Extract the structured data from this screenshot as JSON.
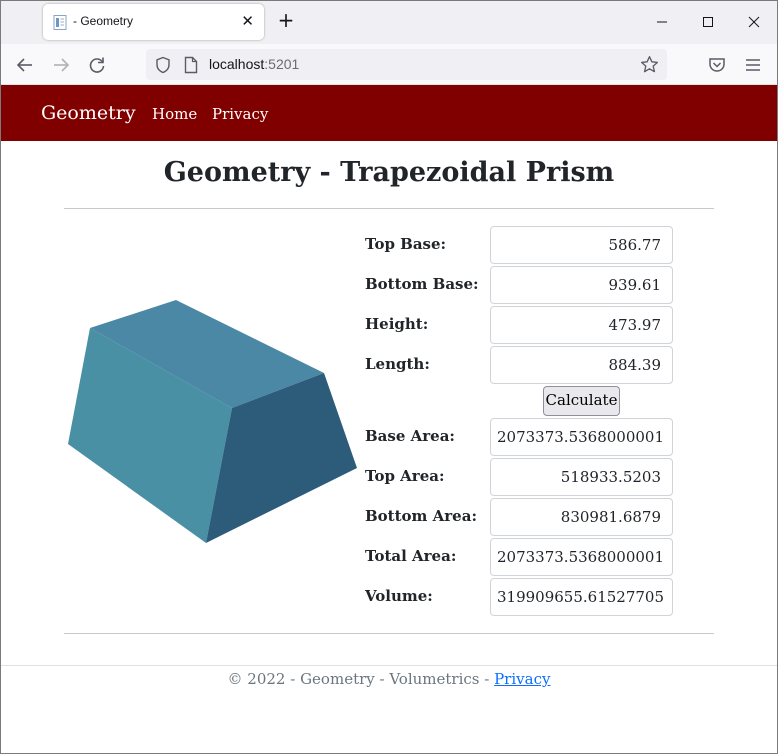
{
  "browser": {
    "tab_title": "- Geometry",
    "url_host": "localhost",
    "url_port": ":5201"
  },
  "site": {
    "brand": "Geometry",
    "nav": [
      "Home",
      "Privacy"
    ],
    "colors": {
      "navbar": "#800000",
      "link": "#0d6efd"
    }
  },
  "page": {
    "title": "Geometry - Trapezoidal Prism",
    "illustration": "trapezoidal-prism-image"
  },
  "form": {
    "inputs": [
      {
        "label": "Top Base:",
        "value": "586.77"
      },
      {
        "label": "Bottom Base:",
        "value": "939.61"
      },
      {
        "label": "Height:",
        "value": "473.97"
      },
      {
        "label": "Length:",
        "value": "884.39"
      }
    ],
    "calculate_label": "Calculate",
    "results": [
      {
        "label": "Base Area:",
        "value": "2073373.5368000001"
      },
      {
        "label": "Top Area:",
        "value": "518933.5203"
      },
      {
        "label": "Bottom Area:",
        "value": "830981.6879"
      },
      {
        "label": "Total Area:",
        "value": "2073373.5368000001"
      },
      {
        "label": "Volume:",
        "value": "319909655.61527705"
      }
    ]
  },
  "footer": {
    "text": "© 2022 - Geometry - Volumetrics - ",
    "link": "Privacy"
  }
}
